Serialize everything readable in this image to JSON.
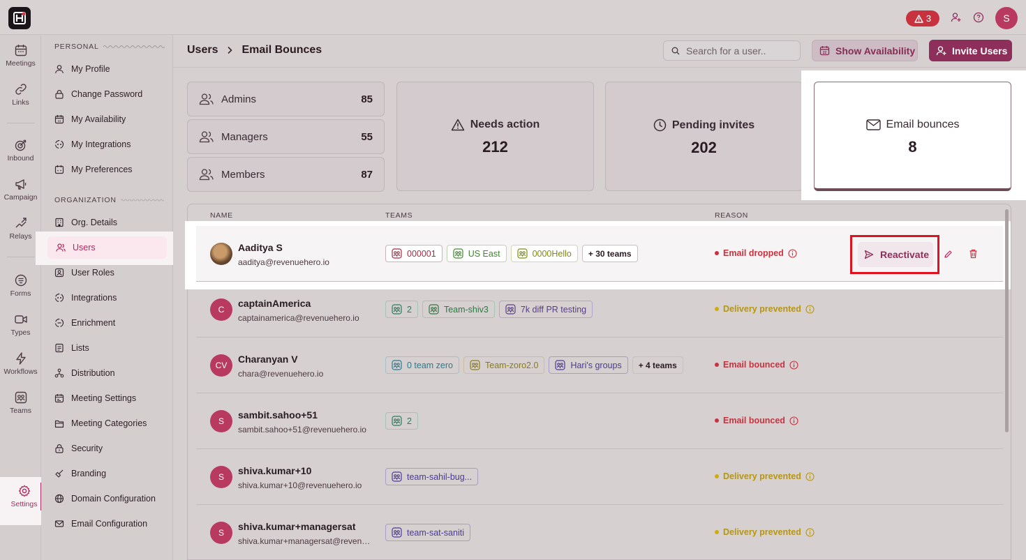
{
  "topbar": {
    "alert_count": "3",
    "user_initial": "S"
  },
  "rail": {
    "items": [
      {
        "label": "Meetings"
      },
      {
        "label": "Links"
      },
      {
        "label": "Inbound"
      },
      {
        "label": "Campaign"
      },
      {
        "label": "Relays"
      },
      {
        "label": "Forms"
      },
      {
        "label": "Types"
      },
      {
        "label": "Workflows"
      },
      {
        "label": "Teams"
      },
      {
        "label": "Settings"
      }
    ]
  },
  "sidebar": {
    "personal_heading": "PERSONAL",
    "organization_heading": "ORGANIZATION",
    "personal": [
      "My Profile",
      "Change Password",
      "My Availability",
      "My Integrations",
      "My Preferences"
    ],
    "organization": [
      "Org. Details",
      "Users",
      "User Roles",
      "Integrations",
      "Enrichment",
      "Lists",
      "Distribution",
      "Meeting Settings",
      "Meeting Categories",
      "Security",
      "Branding",
      "Domain Configuration",
      "Email Configuration"
    ]
  },
  "header": {
    "breadcrumb_root": "Users",
    "breadcrumb_current": "Email Bounces",
    "search_placeholder": "Search for a user..",
    "show_availability": "Show Availability",
    "invite_users": "Invite Users"
  },
  "stats": {
    "admins": {
      "label": "Admins",
      "value": "85"
    },
    "managers": {
      "label": "Managers",
      "value": "55"
    },
    "members": {
      "label": "Members",
      "value": "87"
    },
    "needs_action": {
      "label": "Needs action",
      "value": "212"
    },
    "pending_invites": {
      "label": "Pending invites",
      "value": "202"
    },
    "email_bounces": {
      "label": "Email bounces",
      "value": "8"
    }
  },
  "table": {
    "columns": {
      "name": "NAME",
      "teams": "TEAMS",
      "reason": "REASON"
    },
    "reactivate_label": "Reactivate",
    "rows": [
      {
        "name": "Aaditya S",
        "email": "aaditya@revenuehero.io",
        "initials": "",
        "teams": [
          "000001",
          "US East",
          "0000Hello"
        ],
        "more": "+ 30 teams",
        "reason": "Email dropped"
      },
      {
        "name": "captainAmerica",
        "email": "captainamerica@revenuehero.io",
        "initials": "C",
        "teams": [
          "2",
          "Team-shiv3",
          "7k diff PR testing"
        ],
        "more": "",
        "reason": "Delivery prevented"
      },
      {
        "name": "Charanyan V",
        "email": "chara@revenuehero.io",
        "initials": "CV",
        "teams": [
          "0 team zero",
          "Team-zoro2.0",
          "Hari's groups"
        ],
        "more": "+ 4 teams",
        "reason": "Email bounced"
      },
      {
        "name": "sambit.sahoo+51",
        "email": "sambit.sahoo+51@revenuehero.io",
        "initials": "S",
        "teams": [
          "2"
        ],
        "more": "",
        "reason": "Email bounced"
      },
      {
        "name": "shiva.kumar+10",
        "email": "shiva.kumar+10@revenuehero.io",
        "initials": "S",
        "teams": [
          "team-sahil-bug..."
        ],
        "more": "",
        "reason": "Delivery prevented"
      },
      {
        "name": "shiva.kumar+managersat",
        "email": "shiva.kumar+managersat@revenuehero.io",
        "initials": "S",
        "teams": [
          "team-sat-saniti"
        ],
        "more": "",
        "reason": "Delivery prevented"
      }
    ]
  },
  "colors": {
    "brand": "#8d2e5b",
    "error": "#c8323f",
    "warning": "#d4a912"
  }
}
